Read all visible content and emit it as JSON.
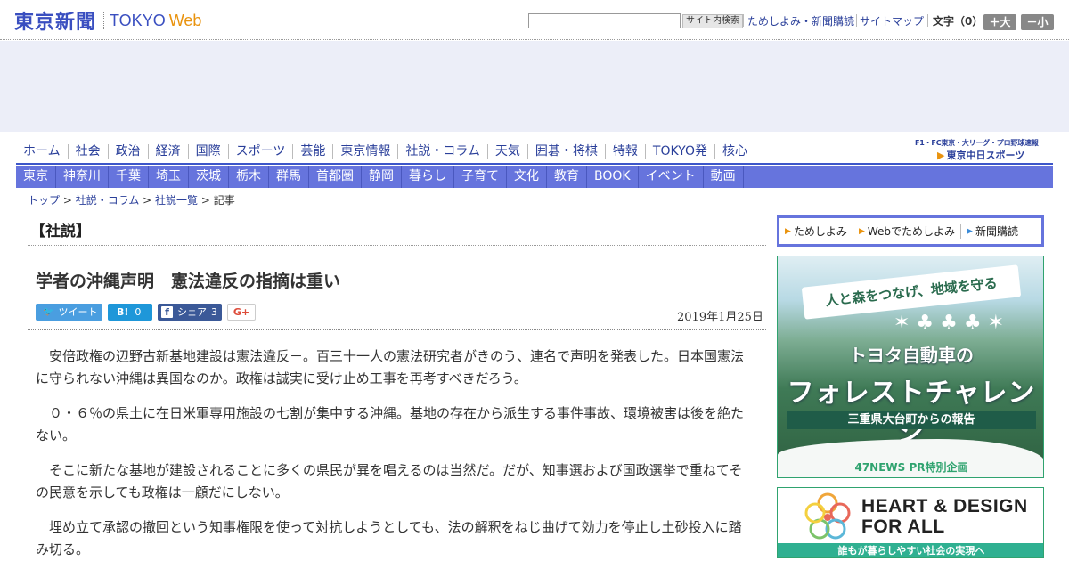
{
  "header": {
    "logo_jp": "東京新聞",
    "logo_tokyo": "TOKYO",
    "logo_web": "Web",
    "search_button": "サイト内検索",
    "links": [
      "ためしよみ・新聞購読",
      "サイトマップ"
    ],
    "font_size_label": "文字（0）",
    "font_larger": "＋大",
    "font_smaller": "－小"
  },
  "main_nav": [
    "ホーム",
    "社会",
    "政治",
    "経済",
    "国際",
    "スポーツ",
    "芸能",
    "東京情報",
    "社説・コラム",
    "天気",
    "囲碁・将棋",
    "特報",
    "TOKYO発",
    "核心"
  ],
  "chunichi": {
    "sub": "F1・FC東京・大リーグ・プロ野球速報",
    "name": "東京中日スポーツ"
  },
  "sub_nav": [
    "東京",
    "神奈川",
    "千葉",
    "埼玉",
    "茨城",
    "栃木",
    "群馬",
    "首都圏",
    "静岡",
    "暮らし",
    "子育て",
    "文化",
    "教育",
    "BOOK",
    "イベント",
    "動画"
  ],
  "breadcrumb": {
    "items": [
      "トップ",
      "社説・コラム",
      "社説一覧"
    ],
    "current": "記事"
  },
  "article": {
    "section": "【社説】",
    "title": "学者の沖縄声明　憲法違反の指摘は重い",
    "date": "2019年1月25日",
    "share": {
      "tweet": "ツイート",
      "hatena_count": "0",
      "facebook": "シェア",
      "facebook_count": "3",
      "gplus": "G+"
    },
    "paragraphs": [
      "安倍政権の辺野古新基地建設は憲法違反－。百三十一人の憲法研究者がきのう、連名で声明を発表した。日本国憲法に守られない沖縄は異国なのか。政権は誠実に受け止め工事を再考すべきだろう。",
      "０・６％の県土に在日米軍専用施設の七割が集中する沖縄。基地の存在から派生する事件事故、環境被害は後を絶たない。",
      "そこに新たな基地が建設されることに多くの県民が異を唱えるのは当然だ。だが、知事選および国政選挙で重ねてその民意を示しても政権は一顧だにしない。",
      "埋め立て承認の撤回という知事権限を使って対抗しようとしても、法の解釈をねじ曲げて効力を停止し土砂投入に踏み切る。"
    ]
  },
  "sidebar": {
    "subscribe_links": [
      "ためしよみ",
      "Webでためしよみ",
      "新聞購読"
    ],
    "triangle_colors": [
      "#e9930e",
      "#e9930e",
      "#3a8bd8"
    ],
    "ad1": {
      "banner": "人と森をつなげ、地域を守る",
      "line1": "トヨタ自動車の",
      "line2": "フォレストチャレンジ",
      "line3": "三重県大台町からの報告",
      "footer": "47NEWS PR特別企画"
    },
    "ad2": {
      "line1": "HEART & DESIGN",
      "line2": "FOR ALL",
      "band": "誰もが暮らしやすい社会の実現へ"
    }
  }
}
